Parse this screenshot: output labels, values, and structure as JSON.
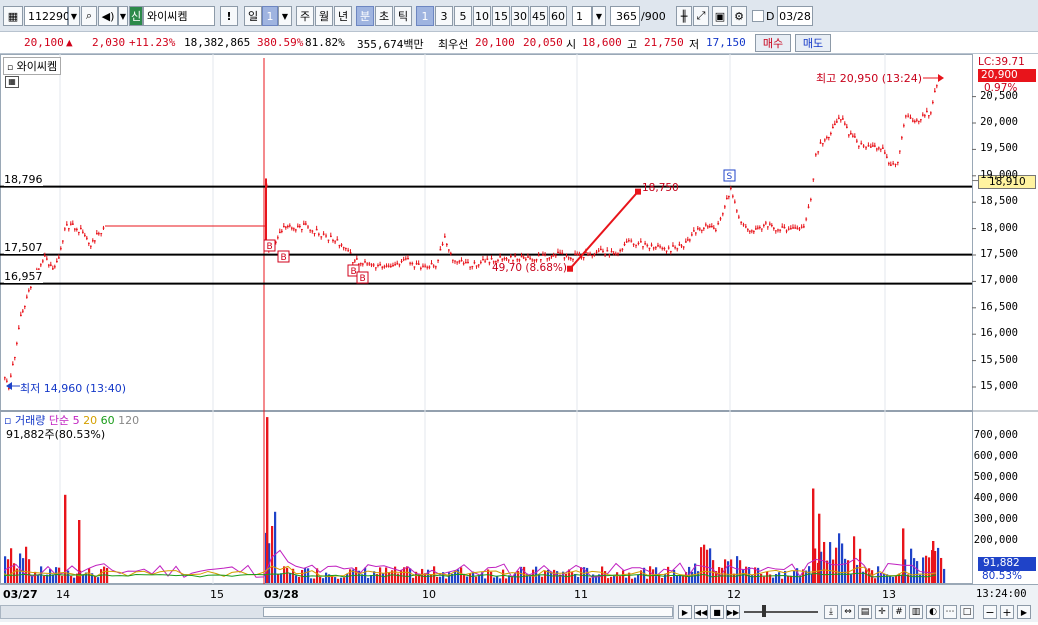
{
  "toolbar": {
    "code": "112290",
    "badge": "신",
    "name": "와이씨켐",
    "alert": "!",
    "period_tabs": [
      "일",
      "1",
      "주",
      "월",
      "년",
      "분",
      "초",
      "틱"
    ],
    "minute_opts": [
      "1",
      "3",
      "5",
      "10",
      "15",
      "30",
      "45",
      "60"
    ],
    "count_select": "1",
    "range": "365",
    "range_total": "/900",
    "date_check": "D",
    "date": "03/28"
  },
  "quote": {
    "price": "20,100",
    "arrow": "▲",
    "change": "2,030",
    "change_pct": "+11.23%",
    "volume": "18,382,865",
    "vol_ratio": "380.59%",
    "ratio2": "81.82%",
    "amount": "355,674백만",
    "bid_label": "최우선",
    "ask": "20,100",
    "bid": "20,050",
    "open_label": "시",
    "open": "18,600",
    "high_label": "고",
    "high": "21,750",
    "low_label": "저",
    "low": "17,150",
    "buy": "매수",
    "sell": "매도"
  },
  "price_panel": {
    "tab": "와이씨켐",
    "lc": "LC:39.71",
    "h_price": "20,900",
    "h_pct": "0.97%",
    "line_price": "18,910",
    "high_note": "최고 20,950 (13:24)",
    "low_note": "최저 14,960 (13:40)",
    "hline_labels": [
      "18,796",
      "17,507",
      "16,957"
    ],
    "trend_start": "49,70 (8.68%)",
    "trend_end": "18,750",
    "signal_buy": "B",
    "signal_sell": "S",
    "axis": [
      "20,500",
      "20,000",
      "19,500",
      "19,000",
      "18,500",
      "18,000",
      "17,500",
      "17,000",
      "16,500",
      "16,000",
      "15,500",
      "15,000"
    ]
  },
  "volume_panel": {
    "title": "거래량",
    "ma_label": "단순",
    "ma_periods": [
      "5",
      "20",
      "60",
      "120"
    ],
    "info": "91,882주(80.53%)",
    "last": "91,882",
    "last_pct": "80.53%",
    "axis": [
      "700,000",
      "600,000",
      "500,000",
      "400,000",
      "300,000",
      "200,000"
    ]
  },
  "time_axis": {
    "labels": [
      "03/27",
      "14",
      "15",
      "03/28",
      "10",
      "11",
      "12",
      "13"
    ],
    "time": "13:24:00"
  },
  "colors": {
    "up": "#e8141b",
    "down": "#1f43c8",
    "hline": "#000000",
    "ma5": "#c020c0",
    "ma20": "#d4a000",
    "ma60": "#1a9c1a",
    "ma120": "#888888"
  }
}
